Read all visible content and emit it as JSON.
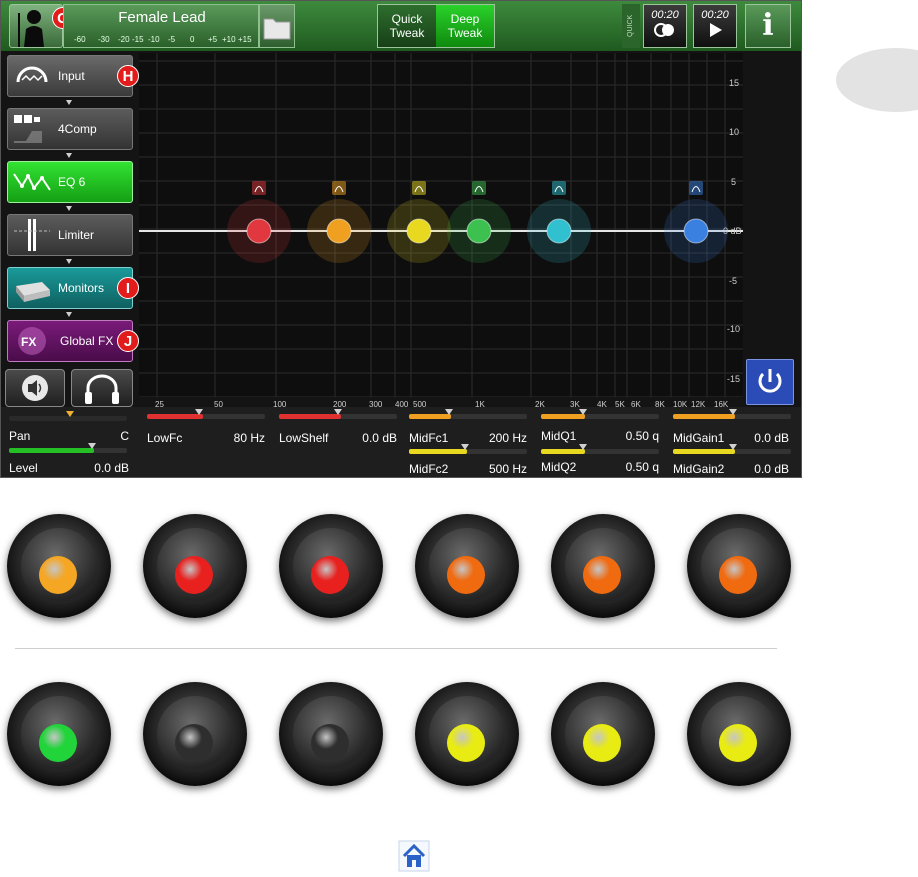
{
  "top_bar": {
    "preset_badge": "G",
    "preset_name": "Female Lead",
    "meter_scale": [
      "-60",
      "-30",
      "-20",
      "-15",
      "-10",
      "-5",
      "0",
      "+5",
      "+10",
      "+15"
    ],
    "quick_tweak_label": "Quick\nTweak",
    "deep_tweak_label": "Deep\nTweak",
    "quick_capture_label": "QUICK CAPTURE",
    "capture_time_1": "00:20",
    "capture_time_2": "00:20",
    "info_label": "i"
  },
  "chain": [
    {
      "label": "Input",
      "badge": "H",
      "icon": "input-dial-icon"
    },
    {
      "label": "4Comp",
      "badge": "",
      "icon": "compressor-icon"
    },
    {
      "label": "EQ 6",
      "badge": "",
      "icon": "eq-curve-icon"
    },
    {
      "label": "Limiter",
      "badge": "",
      "icon": "limiter-icon"
    },
    {
      "label": "Monitors",
      "badge": "I",
      "icon": "monitor-speaker-icon"
    },
    {
      "label": "Global FX",
      "badge": "J",
      "icon": "fx-icon"
    }
  ],
  "eq": {
    "y_labels": [
      "15",
      "10",
      "5",
      "0 dB",
      "-5",
      "-10",
      "-15"
    ],
    "x_labels": [
      "25",
      "50",
      "100",
      "200",
      "300",
      "400",
      "500",
      "1K",
      "2K",
      "3K",
      "4K",
      "5K",
      "6K",
      "8K",
      "10K",
      "12K",
      "16K"
    ],
    "bands": [
      {
        "name": "LowFc",
        "color": "#e0383e"
      },
      {
        "name": "LowShelf",
        "color": "#e0383e"
      },
      {
        "name": "MidFc1",
        "color": "#f0a020"
      },
      {
        "name": "MidQ1",
        "color": "#f0a020"
      },
      {
        "name": "MidGain1",
        "color": "#f0a020"
      },
      {
        "name": "MidFc2",
        "color": "#e8d820"
      }
    ],
    "colors": {
      "red": "#e0383e",
      "orange": "#f0a020",
      "yellow": "#e8d820",
      "green": "#3cc050",
      "cyan": "#30c0d0",
      "blue": "#3a80e0"
    }
  },
  "params": {
    "pan_label": "Pan",
    "pan_value": "C",
    "level_label": "Level",
    "level_value": "0.0 dB",
    "lowfc_label": "LowFc",
    "lowfc_value": "80 Hz",
    "lowshelf_label": "LowShelf",
    "lowshelf_value": "0.0 dB",
    "midfc1_label": "MidFc1",
    "midfc1_value": "200 Hz",
    "midq1_label": "MidQ1",
    "midq1_value": "0.50 q",
    "midgain1_label": "MidGain1",
    "midgain1_value": "0.0 dB",
    "midfc2_label": "MidFc2",
    "midfc2_value": "500 Hz",
    "midq2_label": "MidQ2",
    "midq2_value": "0.50 q",
    "midgain2_label": "MidGain2",
    "midgain2_value": "0.0 dB"
  },
  "knobs_row1": [
    "#f5a623",
    "#e8201e",
    "#e8201e",
    "#f06a10",
    "#f06a10",
    "#f06a10"
  ],
  "knobs_row2": [
    "#21d43a",
    "#2e2e2e",
    "#2e2e2e",
    "#e9ec12",
    "#e9ec12",
    "#e9ec12"
  ]
}
